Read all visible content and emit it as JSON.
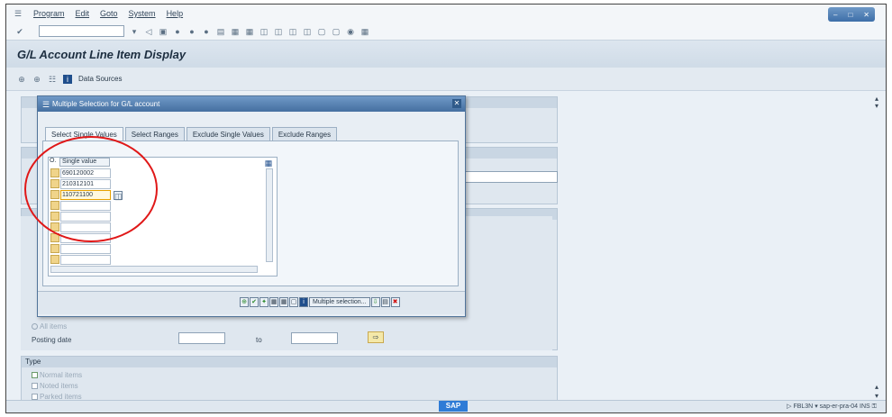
{
  "menu": [
    "Program",
    "Edit",
    "Goto",
    "System",
    "Help"
  ],
  "title": "G/L Account Line Item Display",
  "app_toolbar": {
    "data_sources_label": "Data Sources"
  },
  "dialog": {
    "title": "Multiple Selection for G/L account",
    "tabs": [
      "Select Single Values",
      "Select Ranges",
      "Exclude Single Values",
      "Exclude Ranges"
    ],
    "grid_header": {
      "o_label": "O.",
      "value_label": "Single value"
    },
    "values": [
      "690120002",
      "210312101",
      "110721100"
    ],
    "multiple_selection_label": "Multiple selection..."
  },
  "background": {
    "all_items": "All items",
    "posting_date_label": "Posting date",
    "to_label": "to",
    "type_label": "Type",
    "normal_items": "Normal items",
    "noted_items": "Noted items",
    "parked_items": "Parked items"
  },
  "status": {
    "transaction": "FBL3N",
    "server": "sap-er-pra-04",
    "mode": "INS",
    "logo": "SAP"
  }
}
